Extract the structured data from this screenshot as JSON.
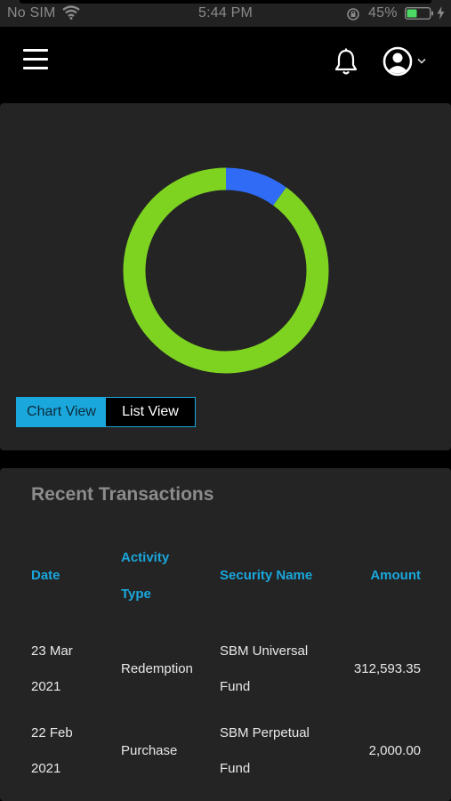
{
  "status_bar": {
    "carrier": "No SIM",
    "time": "5:44 PM",
    "battery_pct": "45%"
  },
  "header": {
    "menu_icon": "hamburger-menu-icon",
    "bell_icon": "bell-icon",
    "profile_icon": "user-circle-icon"
  },
  "chart_data": {
    "type": "pie",
    "style": "donut",
    "slices": [
      {
        "color": "#2f6bf5",
        "fraction": 0.1
      },
      {
        "color": "#7ed321",
        "fraction": 0.9
      }
    ]
  },
  "view_toggle": {
    "chart_label": "Chart View",
    "list_label": "List View",
    "active": "Chart View"
  },
  "transactions": {
    "title": "Recent Transactions",
    "columns": {
      "date": "Date",
      "activity_line1": "Activity",
      "activity_line2": "Type",
      "security": "Security Name",
      "amount": "Amount"
    },
    "rows": [
      {
        "date_line1": "23 Mar",
        "date_line2": "2021",
        "activity": "Redemption",
        "security_line1": "SBM Universal",
        "security_line2": "Fund",
        "amount": "312,593.35"
      },
      {
        "date_line1": "22 Feb",
        "date_line2": "2021",
        "activity": "Purchase",
        "security_line1": "SBM Perpetual",
        "security_line2": "Fund",
        "amount": "2,000.00"
      }
    ]
  },
  "colors": {
    "accent": "#1aa7dc",
    "card": "#242424",
    "background": "#000000"
  }
}
